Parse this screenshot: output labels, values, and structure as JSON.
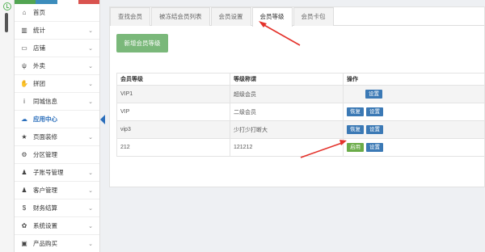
{
  "colors": {
    "accent": "#2a6ebb",
    "arrow": "#e4322b",
    "new_button": "#7ab87a",
    "enable_button": "#6aab48",
    "action_button": "#3b79b5"
  },
  "sidebar": {
    "color_bar": [
      "#52a552",
      "#3c8dbc",
      "#ffffff",
      "#d9534f"
    ],
    "items": [
      {
        "label": "首页",
        "icon": "home-icon",
        "glyph": "⌂",
        "chevron": false
      },
      {
        "label": "统计",
        "icon": "bar-chart-icon",
        "glyph": "▥",
        "chevron": true
      },
      {
        "label": "店铺",
        "icon": "monitor-icon",
        "glyph": "▭",
        "chevron": true
      },
      {
        "label": "外卖",
        "icon": "cutlery-icon",
        "glyph": "ψ",
        "chevron": true
      },
      {
        "label": "拼团",
        "icon": "handshake-icon",
        "glyph": "✋",
        "chevron": true
      },
      {
        "label": "同城信息",
        "icon": "info-icon",
        "glyph": "i",
        "chevron": true
      },
      {
        "label": "应用中心",
        "icon": "cloud-icon",
        "glyph": "☁",
        "chevron": false,
        "active": true
      },
      {
        "label": "页面装修",
        "icon": "star-icon",
        "glyph": "★",
        "chevron": true
      },
      {
        "label": "分区管理",
        "icon": "gear-icon",
        "glyph": "⚙",
        "chevron": false
      },
      {
        "label": "子账号管理",
        "icon": "user-icon",
        "glyph": "♟",
        "chevron": true
      },
      {
        "label": "客户管理",
        "icon": "users-icon",
        "glyph": "♟",
        "chevron": true
      },
      {
        "label": "财务结算",
        "icon": "dollar-icon",
        "glyph": "$",
        "chevron": true
      },
      {
        "label": "系统设置",
        "icon": "cog-icon",
        "glyph": "✿",
        "chevron": true
      },
      {
        "label": "产品购买",
        "icon": "bag-icon",
        "glyph": "▣",
        "chevron": true
      }
    ]
  },
  "tabs": [
    "查找会员",
    "被冻结会员列表",
    "会员设置",
    "会员等级",
    "会员卡包"
  ],
  "active_tab": 3,
  "new_button": "新增会员等级",
  "table": {
    "headers": [
      "会员等级",
      "等级称谓",
      "操作"
    ],
    "rows": [
      {
        "level": "VIP1",
        "title": "超级会员",
        "actions": [
          {
            "label": "设置",
            "style": "blue"
          }
        ],
        "indent": true
      },
      {
        "level": "VIP",
        "title": "二级会员",
        "actions": [
          {
            "label": "恢复",
            "style": "blue"
          },
          {
            "label": "设置",
            "style": "blue"
          }
        ]
      },
      {
        "level": "vip3",
        "title": "少打少打断大",
        "actions": [
          {
            "label": "恢复",
            "style": "blue"
          },
          {
            "label": "设置",
            "style": "blue"
          }
        ]
      },
      {
        "level": "212",
        "title": "121212",
        "actions": [
          {
            "label": "启用",
            "style": "green"
          },
          {
            "label": "设置",
            "style": "blue"
          }
        ]
      }
    ]
  }
}
